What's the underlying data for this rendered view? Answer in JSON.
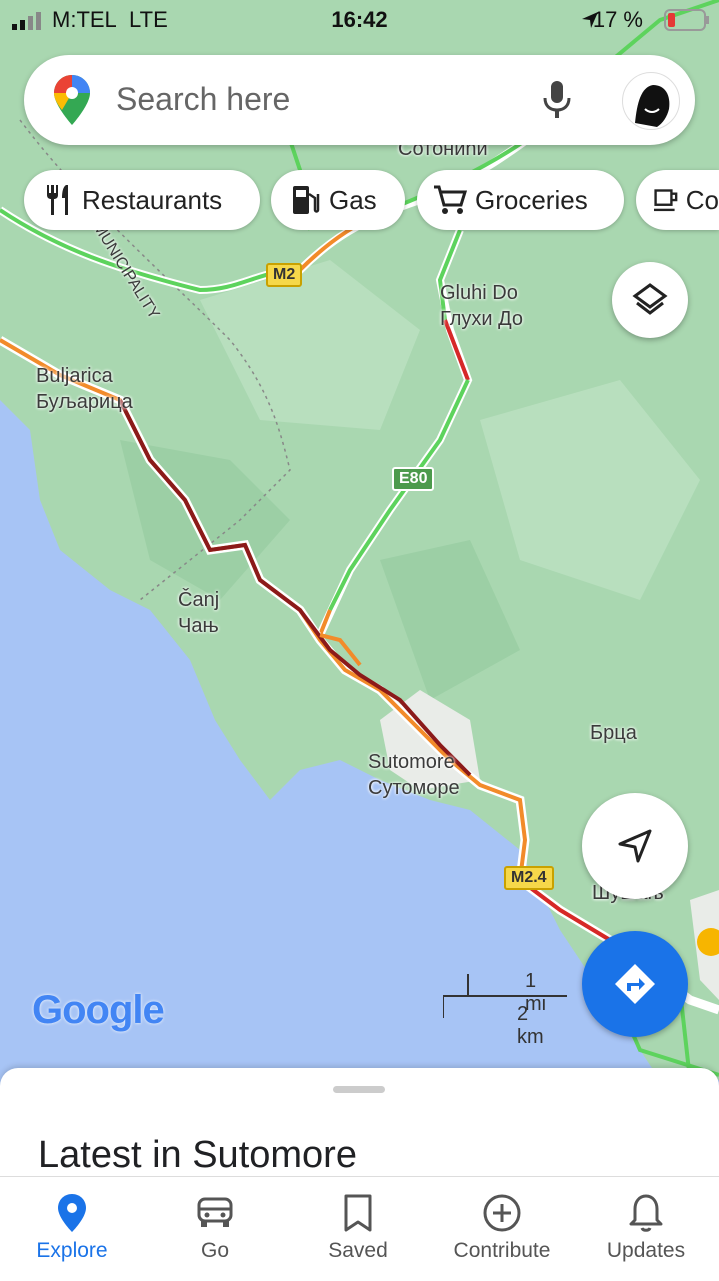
{
  "status_bar": {
    "carrier": "M:TEL",
    "network": "LTE",
    "time": "16:42",
    "battery": "17 %"
  },
  "search": {
    "placeholder": "Search here"
  },
  "chips": [
    {
      "label": "Restaurants",
      "icon": "fork-knife-icon"
    },
    {
      "label": "Gas",
      "icon": "gas-pump-icon"
    },
    {
      "label": "Groceries",
      "icon": "cart-icon"
    },
    {
      "label": "Co",
      "icon": "coffee-icon"
    }
  ],
  "map": {
    "places": [
      {
        "text": "Gluhi Do\nГлухи До"
      },
      {
        "text": "Buljarica\nБуљарица"
      },
      {
        "text": "Čanj\nЧањ"
      },
      {
        "text": "Sutomore\nСутоморе"
      },
      {
        "text": "Брца"
      },
      {
        "text": "Сотонићи"
      },
      {
        "text": "Шушањ"
      },
      {
        "text": "MUNICIPALITY"
      }
    ],
    "road_shields": [
      "M2",
      "E80",
      "M2.4"
    ],
    "scale": {
      "top": "1 mi",
      "bottom": "2 km"
    },
    "brand": "Google"
  },
  "sheet": {
    "title": "Latest in Sutomore"
  },
  "bottom_nav": [
    {
      "label": "Explore",
      "active": true
    },
    {
      "label": "Go"
    },
    {
      "label": "Saved"
    },
    {
      "label": "Contribute"
    },
    {
      "label": "Updates"
    }
  ],
  "colors": {
    "accent": "#1a73e8",
    "land": "#a9d7b0",
    "water": "#a7c4f5",
    "traffic_heavy": "#8b1a1a",
    "traffic_slow": "#f28b2a",
    "traffic_free": "#5dd35d"
  }
}
